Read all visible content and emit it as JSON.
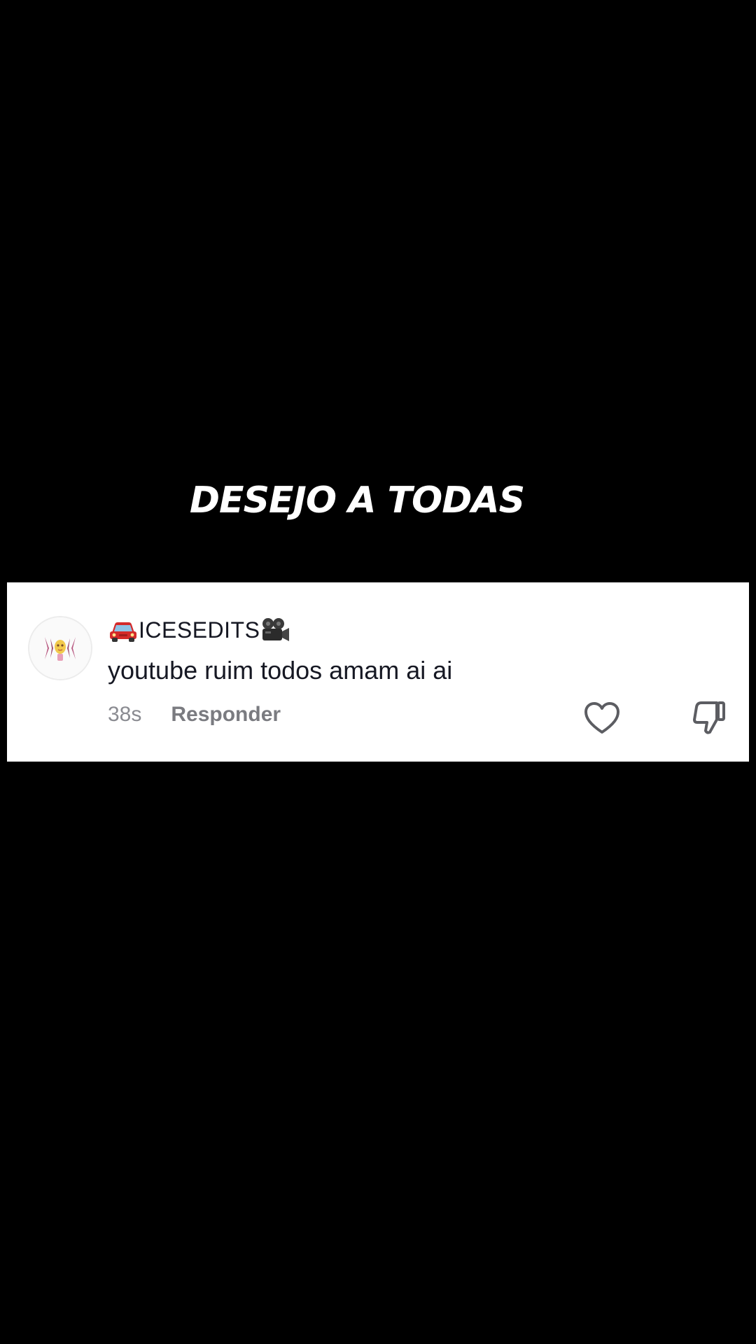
{
  "caption": "DESEJO A TODAS",
  "comment": {
    "username": "ICESEDITS",
    "username_prefix_icon": "car-emoji-icon",
    "username_suffix_icon": "movie-camera-emoji-icon",
    "text": "youtube ruim todos amam ai ai",
    "timestamp": "38s",
    "reply_label": "Responder",
    "like_icon": "heart-outline-icon",
    "dislike_icon": "thumbs-down-icon"
  },
  "colors": {
    "background": "#000000",
    "card": "#ffffff",
    "text_primary": "#161823",
    "text_secondary": "#8a8b91"
  }
}
